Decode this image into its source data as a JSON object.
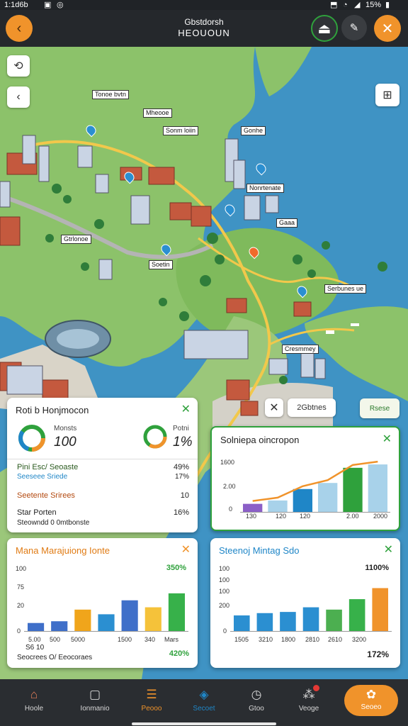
{
  "status_bar": {
    "time": "1:1d6b",
    "battery": "15%"
  },
  "header": {
    "title_line1": "Gbstdorsh",
    "title_line2": "HEOUOUN"
  },
  "map": {
    "labels": [
      "Tonoe bvtn",
      "Mheooe",
      "Sonm loiin",
      "Gonhe",
      "Nonrtenate",
      "Gaaa",
      "Gtrlonoe",
      "Soetin",
      "Serbunes ue",
      "Cresmmey"
    ]
  },
  "map_controls": {
    "counter_label": "2Gbtnes",
    "badge_label": "Rsese"
  },
  "card1": {
    "title": "Roti b Honjmocon",
    "metric1_label": "Monsts",
    "metric1_value": "100",
    "metric2_label": "Potni",
    "metric2_value": "1%",
    "rows": [
      {
        "label": "Pini Esc/ Seoaste",
        "value": "49%"
      },
      {
        "label": "Seeseee Sriede",
        "value": "17%"
      },
      {
        "label": "Seetente Srirees",
        "value": "10"
      },
      {
        "label": "Star Porten",
        "value": "16%"
      }
    ],
    "footer": "Steowndd 0 0mtbonste"
  },
  "card2": {
    "title": "Solniepa oincropon",
    "y_ticks": [
      "1600",
      "2.00",
      "0"
    ],
    "x_ticks": [
      "130",
      "120",
      "120",
      "2.00",
      "2000"
    ]
  },
  "card3": {
    "title": "Mana Marajuiong Ionte",
    "top_value": "350%",
    "bottom_value": "420%",
    "y_ticks": [
      "100",
      "75",
      "20",
      "0"
    ],
    "x_ticks": [
      "5.00",
      "500",
      "5000",
      "1500",
      "340",
      "Mars"
    ],
    "footer_line1": "S6 10",
    "footer_line2": "Seocrees O/ Eeocoraes"
  },
  "card4": {
    "title": "Steenoj Mintag Sdo",
    "top_value": "1100%",
    "bottom_value": "172%",
    "y_ticks": [
      "100",
      "100",
      "100",
      "200",
      "0"
    ],
    "x_ticks": [
      "1505",
      "3210",
      "1800",
      "2810",
      "2610",
      "3200"
    ]
  },
  "chart_data": [
    {
      "type": "bar",
      "title": "Solniepa oincropon",
      "categories": [
        "130",
        "120",
        "120",
        "2.00",
        "2000"
      ],
      "values": [
        260,
        360,
        700,
        880,
        1330,
        1430
      ],
      "ylim": [
        0,
        1600
      ]
    },
    {
      "type": "bar",
      "title": "Mana Marajuiong Ionte",
      "categories": [
        "5.00",
        "500",
        "5000",
        "1500",
        "340",
        "Mars"
      ],
      "values": [
        15,
        18,
        38,
        30,
        54,
        42,
        66
      ],
      "ylim": [
        0,
        100
      ]
    },
    {
      "type": "bar",
      "title": "Steenoj Mintag Sdo",
      "categories": [
        "1505",
        "3210",
        "1800",
        "2810",
        "2610",
        "3200"
      ],
      "values": [
        28,
        32,
        34,
        42,
        38,
        56,
        75
      ],
      "ylim": [
        0,
        100
      ]
    }
  ],
  "nav": {
    "items": [
      {
        "label": "Hoole",
        "icon": "home-icon"
      },
      {
        "label": "Ionmanio",
        "icon": "image-icon"
      },
      {
        "label": "Peooo",
        "icon": "list-icon"
      },
      {
        "label": "Secoet",
        "icon": "compass-icon"
      },
      {
        "label": "Gtoo",
        "icon": "clock-icon"
      },
      {
        "label": "Veoge",
        "icon": "graph-icon"
      },
      {
        "label": "Seoeo",
        "icon": "apps-icon"
      }
    ]
  },
  "colors": {
    "accent": "#f0932b",
    "positive": "#2fa13c",
    "info": "#1f86c7"
  }
}
